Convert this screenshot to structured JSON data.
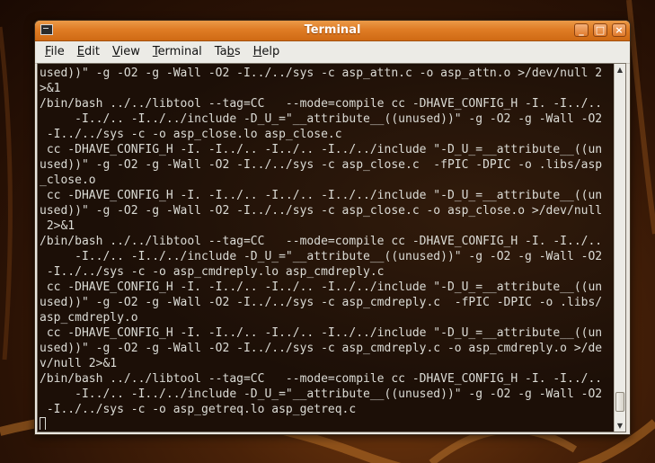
{
  "window": {
    "title": "Terminal"
  },
  "title_buttons": {
    "minimize": "_",
    "maximize": "□",
    "close": "×"
  },
  "menu": [
    {
      "mnemonic": "F",
      "rest": "ile"
    },
    {
      "mnemonic": "E",
      "rest": "dit"
    },
    {
      "mnemonic": "V",
      "rest": "iew"
    },
    {
      "mnemonic": "T",
      "rest": "erminal"
    },
    {
      "prefix": "Ta",
      "mnemonic": "b",
      "rest": "s"
    },
    {
      "mnemonic": "H",
      "rest": "elp"
    }
  ],
  "terminal": {
    "lines": [
      "used))\" -g -O2 -g -Wall -O2 -I../../sys -c asp_attn.c -o asp_attn.o >/dev/null 2",
      ">&1",
      "/bin/bash ../../libtool --tag=CC   --mode=compile cc -DHAVE_CONFIG_H -I. -I../..",
      "     -I../.. -I../../include -D_U_=\"__attribute__((unused))\" -g -O2 -g -Wall -O2",
      " -I../../sys -c -o asp_close.lo asp_close.c",
      " cc -DHAVE_CONFIG_H -I. -I../.. -I../.. -I../../include \"-D_U_=__attribute__((un",
      "used))\" -g -O2 -g -Wall -O2 -I../../sys -c asp_close.c  -fPIC -DPIC -o .libs/asp",
      "_close.o",
      " cc -DHAVE_CONFIG_H -I. -I../.. -I../.. -I../../include \"-D_U_=__attribute__((un",
      "used))\" -g -O2 -g -Wall -O2 -I../../sys -c asp_close.c -o asp_close.o >/dev/null",
      " 2>&1",
      "/bin/bash ../../libtool --tag=CC   --mode=compile cc -DHAVE_CONFIG_H -I. -I../..",
      "     -I../.. -I../../include -D_U_=\"__attribute__((unused))\" -g -O2 -g -Wall -O2",
      " -I../../sys -c -o asp_cmdreply.lo asp_cmdreply.c",
      " cc -DHAVE_CONFIG_H -I. -I../.. -I../.. -I../../include \"-D_U_=__attribute__((un",
      "used))\" -g -O2 -g -Wall -O2 -I../../sys -c asp_cmdreply.c  -fPIC -DPIC -o .libs/",
      "asp_cmdreply.o",
      " cc -DHAVE_CONFIG_H -I. -I../.. -I../.. -I../../include \"-D_U_=__attribute__((un",
      "used))\" -g -O2 -g -Wall -O2 -I../../sys -c asp_cmdreply.c -o asp_cmdreply.o >/de",
      "v/null 2>&1",
      "/bin/bash ../../libtool --tag=CC   --mode=compile cc -DHAVE_CONFIG_H -I. -I../..",
      "     -I../.. -I../../include -D_U_=\"__attribute__((unused))\" -g -O2 -g -Wall -O2",
      " -I../../sys -c -o asp_getreq.lo asp_getreq.c"
    ]
  },
  "scrollbar": {
    "up_arrow": "▲",
    "down_arrow": "▼"
  },
  "colors": {
    "titlebar_accent": "#df7c25",
    "terminal_background": "#1c0f07",
    "terminal_text": "#dcdcd6"
  }
}
